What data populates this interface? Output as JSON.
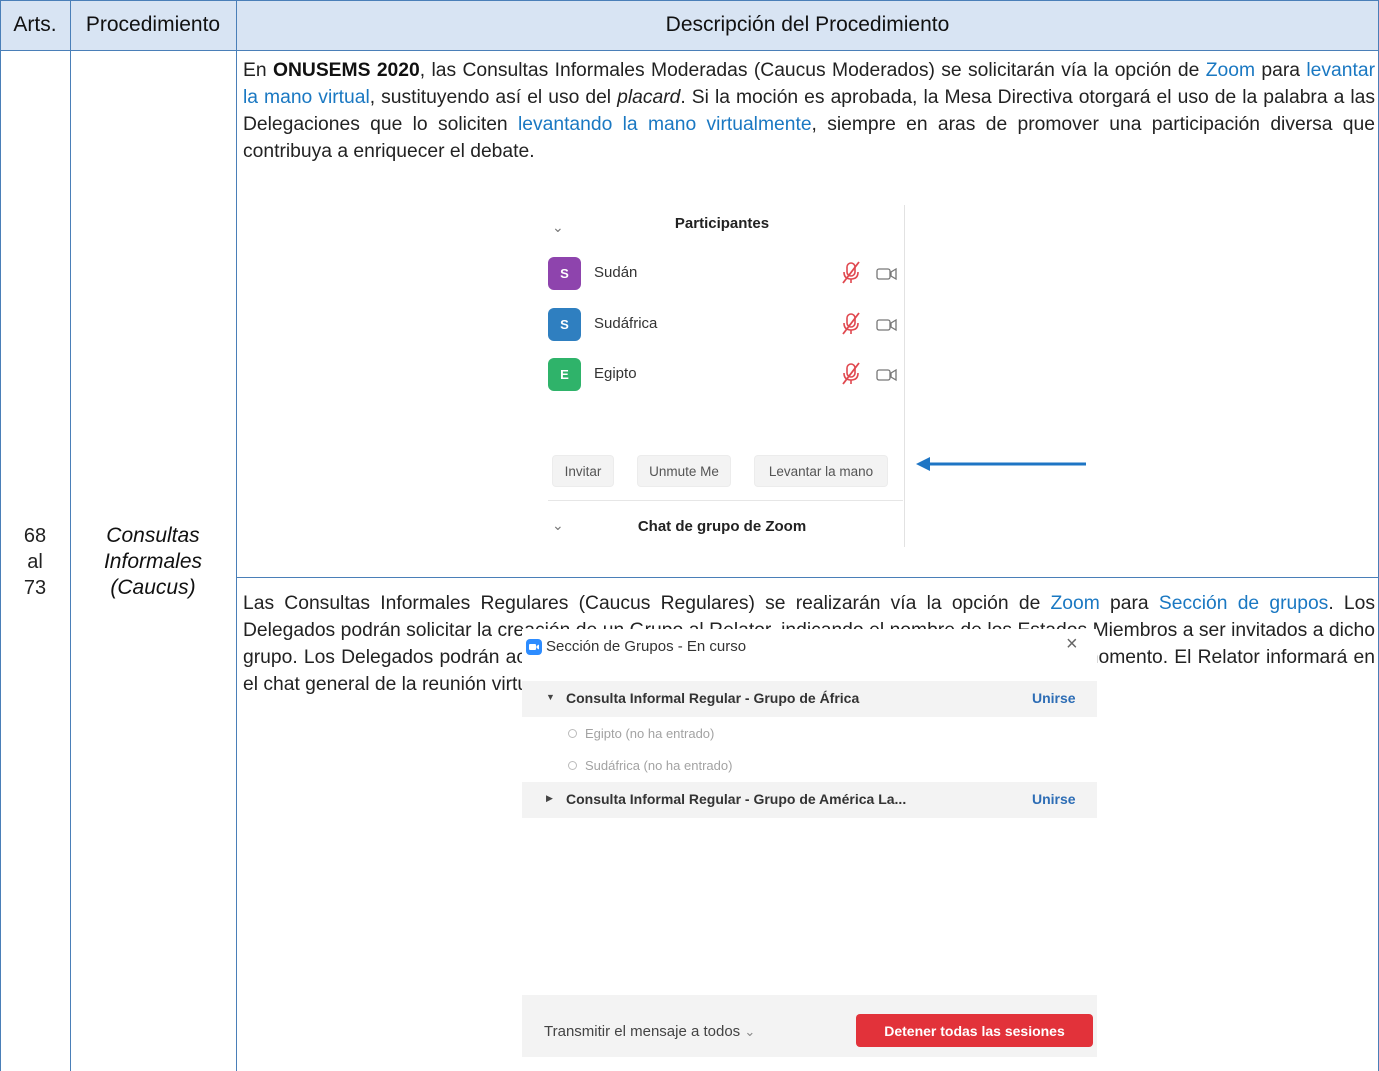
{
  "header": {
    "col1": "Arts.",
    "col2": "Procedimiento",
    "col3": "Descripción del Procedimiento"
  },
  "row": {
    "arts_line1": "68",
    "arts_line2": "al",
    "arts_line3": "73",
    "proc_line1": "Consultas",
    "proc_line2": "Informales",
    "proc_line3": "(Caucus)"
  },
  "para1": {
    "t1": "En ",
    "bold1": "ONUSEMS 2020",
    "t2": ", las Consultas Informales Moderadas (Caucus Moderados) se solicitarán vía la opción de ",
    "hl1": "Zoom",
    "t3": " para ",
    "hl2": "levantar la mano virtual",
    "t4": ", sustituyendo así el uso del ",
    "it1": "placard",
    "t5": ". Si la moción es aprobada, la Mesa Directiva otorgará el uso de la palabra a las Delegaciones que lo soliciten ",
    "hl3": "levantando la mano virtualmente",
    "t6": ", siempre en aras de promover una participación diversa que contribuya a enriquecer el debate."
  },
  "participants_panel": {
    "title": "Participantes",
    "participants": [
      {
        "initial": "S",
        "name": "Sudán",
        "color": "#8e44ad"
      },
      {
        "initial": "S",
        "name": "Sudáfrica",
        "color": "#2f7fc0"
      },
      {
        "initial": "E",
        "name": "Egipto",
        "color": "#2fb36a"
      }
    ],
    "buttons": {
      "invite": "Invitar",
      "unmute": "Unmute Me",
      "raise_hand": "Levantar la mano"
    },
    "chat_title": "Chat de grupo de Zoom"
  },
  "para2": {
    "t1": "Las Consultas Informales Regulares (Caucus Regulares) se realizarán vía la opción de ",
    "hl1": "Zoom",
    "t2": " para ",
    "hl2": "Sección de grupos",
    "t3": ". Los Delegados podrán solicitar la creación de un Grupo al Relator, indicando el nombre de los Estados Miembros a ser invitados a dicho grupo. Los Delegados podrán aceptar o no dicha invitación y podrán salir del grupo en cualquier momento. El Relator informará en el chat general de la reunión virtual sobre los distintos grupos reunidos."
  },
  "breakout_panel": {
    "title": "Sección de Grupos - En curso",
    "close": "×",
    "groups": [
      {
        "arrow": "▼",
        "name": "Consulta Informal Regular - Grupo de África",
        "join": "Unirse"
      },
      {
        "arrow": "▶",
        "name": "Consulta Informal Regular - Grupo de América La...",
        "join": "Unirse"
      }
    ],
    "members": [
      "Egipto (no ha entrado)",
      "Sudáfrica (no ha entrado)"
    ],
    "broadcast": "Transmitir el mensaje a todos",
    "broadcast_chevron": "⌄",
    "stop": "Detener todas las sesiones"
  },
  "colors": {
    "accent": "#1a78c2",
    "border": "#4a7fb8",
    "header_bg": "#d8e4f3",
    "arrow": "#1e75c4",
    "stop_button": "#e2323a"
  }
}
